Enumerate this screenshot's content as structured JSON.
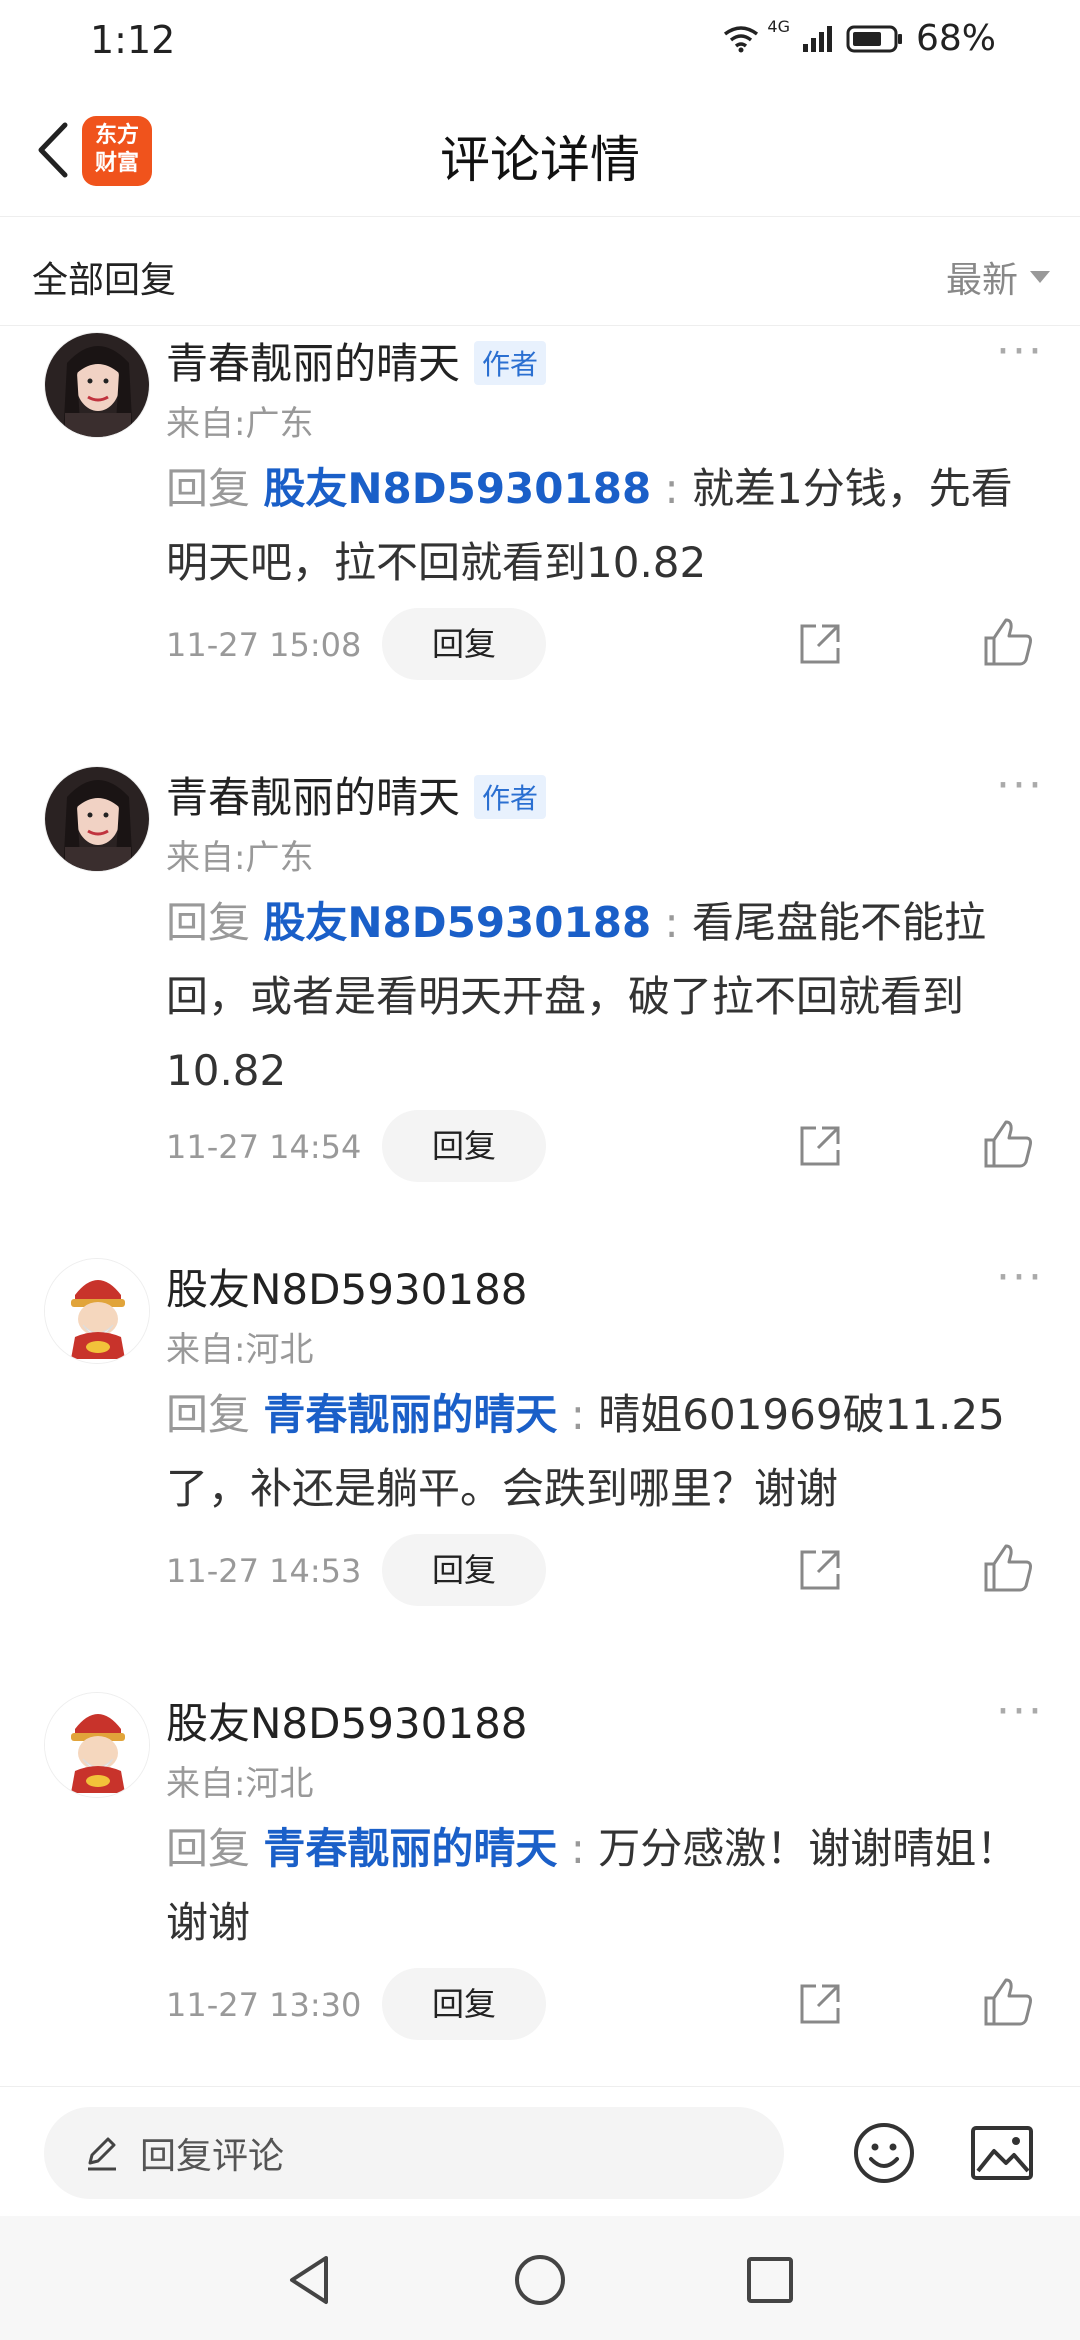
{
  "status_bar": {
    "time": "1:12",
    "network": "4G",
    "battery": "68%"
  },
  "header": {
    "title": "评论详情",
    "logo_line1": "东方",
    "logo_line2": "财富",
    "logo_color": "#f0531c"
  },
  "section": {
    "title": "全部回复",
    "sort_label": "最新"
  },
  "accent_color": "#1a5fc8",
  "comments": [
    {
      "user": "青春靓丽的晴天",
      "author_tag": "作者",
      "from": "来自:广东",
      "reply_word": "回复",
      "mention": "股友N8D5930188",
      "colon": " : ",
      "text": "就差1分钱，先看明天吧，拉不回就看到10.82",
      "date": "11-27 15:08",
      "reply_btn": "回复",
      "avatar_icon": "woman-avatar"
    },
    {
      "user": "青春靓丽的晴天",
      "author_tag": "作者",
      "from": "来自:广东",
      "reply_word": "回复",
      "mention": "股友N8D5930188",
      "colon": " : ",
      "text": "看尾盘能不能拉回，或者是看明天开盘，破了拉不回就看到10.82",
      "date": "11-27 14:54",
      "reply_btn": "回复",
      "avatar_icon": "woman-avatar"
    },
    {
      "user": "股友N8D5930188",
      "author_tag": "",
      "from": "来自:河北",
      "reply_word": "回复",
      "mention": "青春靓丽的晴天",
      "colon": " : ",
      "text": "晴姐601969破11.25了，补还是躺平。会跌到哪里？谢谢",
      "date": "11-27 14:53",
      "reply_btn": "回复",
      "avatar_icon": "fortune-god-avatar"
    },
    {
      "user": "股友N8D5930188",
      "author_tag": "",
      "from": "来自:河北",
      "reply_word": "回复",
      "mention": "青春靓丽的晴天",
      "colon": " : ",
      "text": "万分感激！谢谢晴姐！谢谢",
      "date": "11-27 13:30",
      "reply_btn": "回复",
      "avatar_icon": "fortune-god-avatar"
    }
  ],
  "bottom_bar": {
    "input_placeholder": "回复评论"
  }
}
